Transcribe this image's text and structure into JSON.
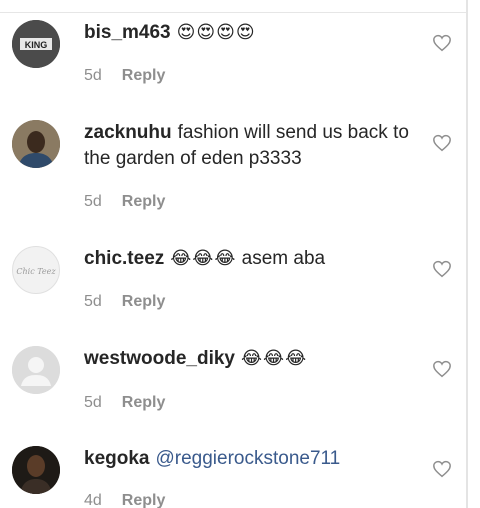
{
  "comments": [
    {
      "username": "bis_m463",
      "text": "",
      "emojis": "😍😍😍😍",
      "mention": "",
      "age": "5d",
      "reply_label": "Reply",
      "avatar_text": "KING"
    },
    {
      "username": "zacknuhu",
      "text": "fashion will send us back to the garden of eden p3333",
      "emojis": "",
      "mention": "",
      "age": "5d",
      "reply_label": "Reply"
    },
    {
      "username": "chic.teez",
      "text": "asem aba",
      "emojis": "😂😂😂",
      "mention": "",
      "age": "5d",
      "reply_label": "Reply",
      "avatar_text": "Chic Teez"
    },
    {
      "username": "westwoode_diky",
      "text": "",
      "emojis": "😂😂😂",
      "mention": "",
      "age": "5d",
      "reply_label": "Reply"
    },
    {
      "username": "kegoka",
      "text": "",
      "emojis": "",
      "mention": "@reggierockstone711",
      "age": "4d",
      "reply_label": "Reply"
    }
  ],
  "icons": {
    "like": "heart-outline-icon"
  },
  "colors": {
    "text": "#262626",
    "meta": "#8e8e8e",
    "mention": "#3a5a8c"
  }
}
